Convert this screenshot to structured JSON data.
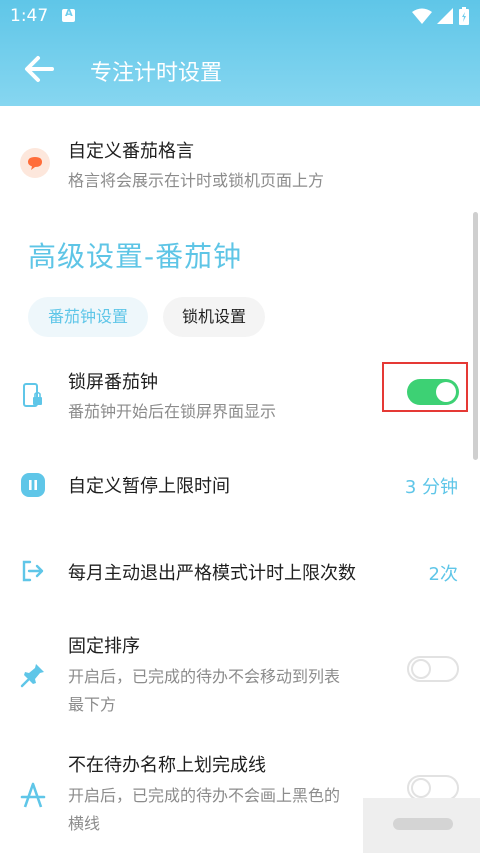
{
  "status_bar": {
    "time": "1:47"
  },
  "app_bar": {
    "title": "专注计时设置"
  },
  "motto": {
    "title": "自定义番茄格言",
    "subtitle": "格言将会展示在计时或锁机页面上方"
  },
  "section": {
    "title": "高级设置-番茄钟",
    "tabs": [
      {
        "label": "番茄钟设置",
        "active": true
      },
      {
        "label": "锁机设置",
        "active": false
      }
    ]
  },
  "settings": {
    "lock_screen": {
      "title": "锁屏番茄钟",
      "subtitle": "番茄钟开始后在锁屏界面显示",
      "enabled": true
    },
    "pause_limit": {
      "title": "自定义暂停上限时间",
      "value": "3 分钟"
    },
    "exit_limit": {
      "title": "每月主动退出严格模式计时上限次数",
      "value": "2次"
    },
    "fixed_order": {
      "title": "固定排序",
      "subtitle_line1": "开启后，已完成的待办不会移动到列表",
      "subtitle_line2": "最下方",
      "enabled": false
    },
    "no_strike": {
      "title": "不在待办名称上划完成线",
      "subtitle_line1": "开启后，已完成的待办不会画上黑色的",
      "subtitle_line2": "横线",
      "enabled": false
    }
  },
  "colors": {
    "accent": "#5fc6e8",
    "toggle_on": "#3dd174",
    "highlight": "#e53935"
  }
}
